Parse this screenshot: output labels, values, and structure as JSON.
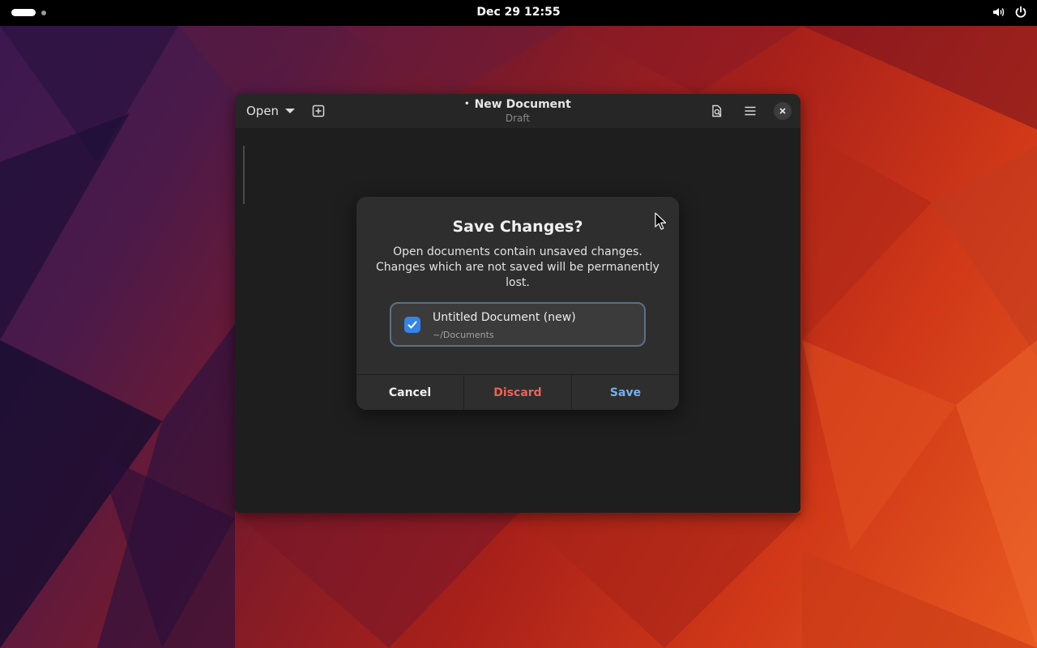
{
  "topbar": {
    "clock": "Dec 29  12:55",
    "icons": [
      "activities-indicator",
      "volume-icon",
      "power-icon"
    ]
  },
  "window": {
    "open_label": "Open",
    "title": "New Document",
    "unsaved_marker": "•",
    "subtitle": "Draft",
    "icons": [
      "new-tab-icon",
      "document-search-icon",
      "hamburger-menu-icon",
      "close-icon"
    ]
  },
  "dialog": {
    "title": "Save Changes?",
    "body": "Open documents contain unsaved changes. Changes which are not saved will be permanently lost.",
    "documents": [
      {
        "name": "Untitled Document (new)",
        "path": "~/Documents",
        "checked": true
      }
    ],
    "buttons": {
      "cancel": "Cancel",
      "discard": "Discard",
      "save": "Save"
    }
  },
  "colors": {
    "accent": "#3584e4",
    "destructive": "#e8635a",
    "suggested": "#78aeed"
  }
}
